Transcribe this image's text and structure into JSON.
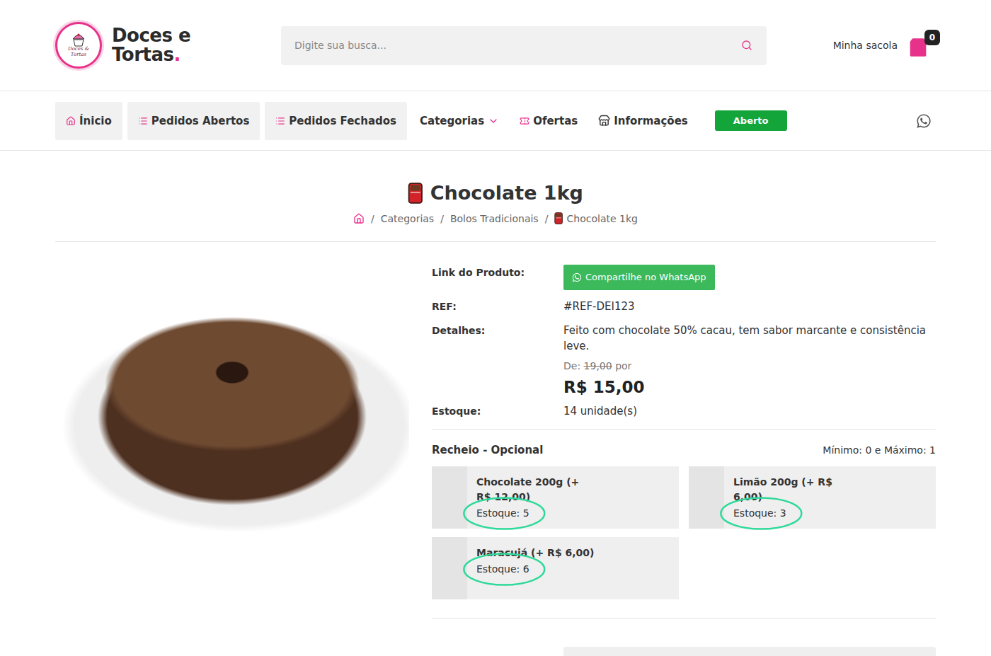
{
  "header": {
    "logo_mark": "Doces & Tortas",
    "brand": {
      "line1": "Doces e",
      "line2": "Tortas",
      "dot": "."
    },
    "search": {
      "placeholder": "Digite sua busca..."
    },
    "cart": {
      "label": "Minha sacola",
      "count": "0"
    }
  },
  "nav": {
    "items": [
      {
        "label": "Ínicio",
        "kind": "home"
      },
      {
        "label": "Pedidos Abertos",
        "kind": "list"
      },
      {
        "label": "Pedidos Fechados",
        "kind": "list"
      },
      {
        "label": "Categorias",
        "kind": "dropdown"
      },
      {
        "label": "Ofertas",
        "kind": "ticket"
      },
      {
        "label": "Informações",
        "kind": "store"
      }
    ],
    "status": "Aberto"
  },
  "product": {
    "title": "Chocolate 1kg",
    "breadcrumb": {
      "separator": "/",
      "items": [
        {
          "label": "",
          "kind": "home"
        },
        {
          "label": "Categorias",
          "kind": "link"
        },
        {
          "label": "Bolos Tradicionais",
          "kind": "link"
        },
        {
          "label": "Chocolate 1kg",
          "kind": "current"
        }
      ]
    },
    "link_label": "Link do Produto:",
    "share_button": "Compartilhe no WhatsApp",
    "ref_label": "REF:",
    "ref": "#REF-DEI123",
    "details_label": "Detalhes:",
    "details": "Feito com chocolate 50% cacau, tem sabor marcante e consistência leve.",
    "price": {
      "from_label": "De:",
      "old": "19,00",
      "by": "por",
      "current": "R$ 15,00"
    },
    "stock_label": "Estoque:",
    "stock": "14 unidade(s)"
  },
  "options": {
    "title": "Recheio - Opcional",
    "limits": "Mínimo: 0 e Máximo: 1",
    "items": [
      {
        "name": "Chocolate 200g (+ R$ 12,00)",
        "stock": "Estoque: 5",
        "circled": true
      },
      {
        "name": "Limão 200g (+ R$ 6,00)",
        "stock": "Estoque: 3",
        "circled": true
      },
      {
        "name": "Maracujá (+ R$ 6,00)",
        "stock": "Estoque: 6",
        "circled": true
      }
    ]
  }
}
